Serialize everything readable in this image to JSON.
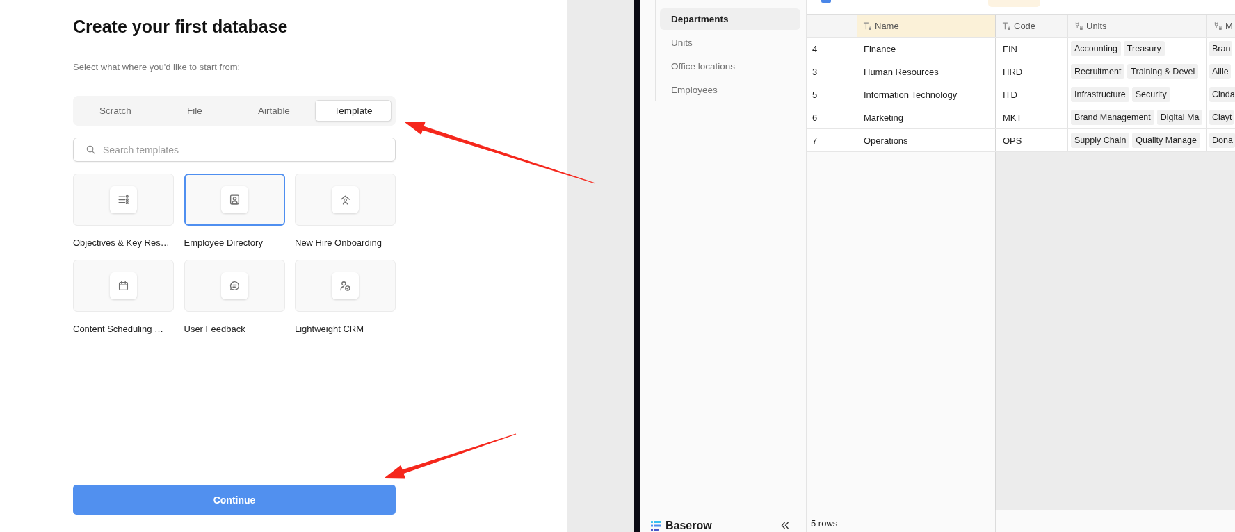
{
  "setup": {
    "title": "Create your first database",
    "subtitle": "Select what where you'd like to start from:",
    "tabs": [
      {
        "label": "Scratch",
        "selected": false
      },
      {
        "label": "File",
        "selected": false
      },
      {
        "label": "Airtable",
        "selected": false
      },
      {
        "label": "Template",
        "selected": true
      }
    ],
    "search": {
      "placeholder": "Search templates"
    },
    "templates": [
      {
        "label": "Objectives & Key Res…",
        "selected": false
      },
      {
        "label": "Employee Directory",
        "selected": true
      },
      {
        "label": "New Hire Onboarding",
        "selected": false
      },
      {
        "label": "Content Scheduling …",
        "selected": false
      },
      {
        "label": "User Feedback",
        "selected": false
      },
      {
        "label": "Lightweight CRM",
        "selected": false
      }
    ],
    "continue_button": "Continue"
  },
  "database_app": {
    "sidebar": {
      "items": [
        {
          "label": "Departments",
          "selected": true
        },
        {
          "label": "Units",
          "selected": false
        },
        {
          "label": "Office locations",
          "selected": false
        },
        {
          "label": "Employees",
          "selected": false
        }
      ],
      "brand": "Baserow"
    },
    "table": {
      "columns": [
        {
          "label": "Name",
          "kind": "text",
          "highlighted": true
        },
        {
          "label": "Code",
          "kind": "text",
          "highlighted": false
        },
        {
          "label": "Units",
          "kind": "link",
          "highlighted": false
        },
        {
          "label": "M",
          "kind": "link",
          "highlighted": false
        }
      ],
      "rows": [
        {
          "id": "4",
          "cells": [
            "Finance",
            "FIN",
            [
              "Accounting",
              "Treasury"
            ],
            [
              "Bran"
            ]
          ]
        },
        {
          "id": "3",
          "cells": [
            "Human Resources",
            "HRD",
            [
              "Recruitment",
              "Training & Devel"
            ],
            [
              "Allie"
            ]
          ]
        },
        {
          "id": "5",
          "cells": [
            "Information Technology",
            "ITD",
            [
              "Infrastructure",
              "Security"
            ],
            [
              "Cinda"
            ]
          ]
        },
        {
          "id": "6",
          "cells": [
            "Marketing",
            "MKT",
            [
              "Brand Management",
              "Digital Ma"
            ],
            [
              "Clayt"
            ]
          ]
        },
        {
          "id": "7",
          "cells": [
            "Operations",
            "OPS",
            [
              "Supply Chain",
              "Quality Manage"
            ],
            [
              "Dona"
            ]
          ]
        }
      ],
      "row_count": "5 rows"
    }
  }
}
